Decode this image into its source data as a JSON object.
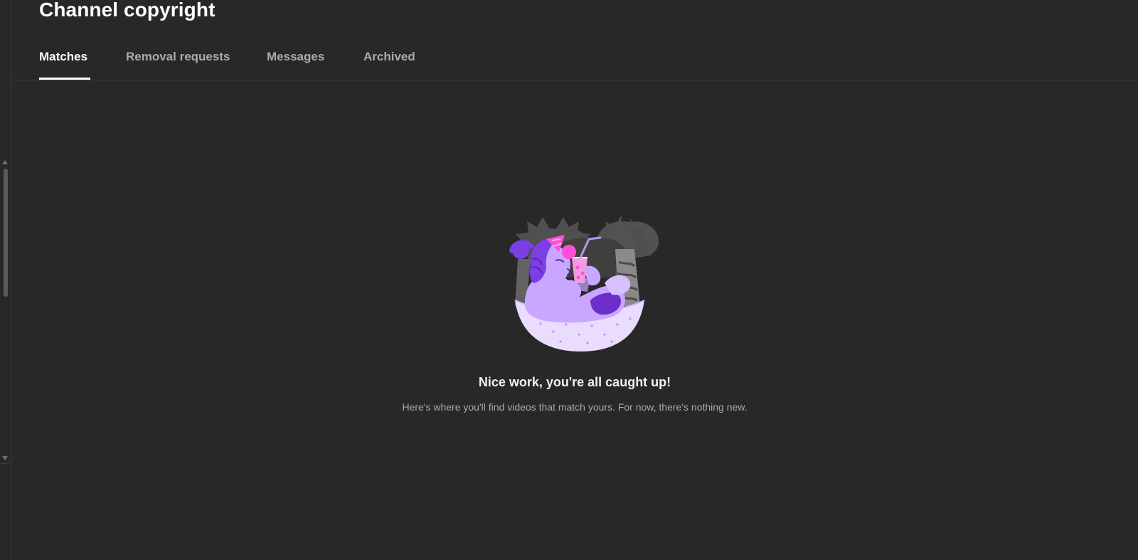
{
  "page": {
    "title": "Channel copyright"
  },
  "tabs": [
    {
      "label": "Matches",
      "active": true
    },
    {
      "label": "Removal requests",
      "active": false
    },
    {
      "label": "Messages",
      "active": false
    },
    {
      "label": "Archived",
      "active": false
    }
  ],
  "empty_state": {
    "title": "Nice work, you're all caught up!",
    "subtitle": "Here's where you'll find videos that match yours. For now, there's nothing new."
  },
  "colors": {
    "background": "#282828",
    "illustration_primary": "#7b3fe4",
    "illustration_light": "#c9a6ff",
    "illustration_accent": "#ff4fd8"
  }
}
